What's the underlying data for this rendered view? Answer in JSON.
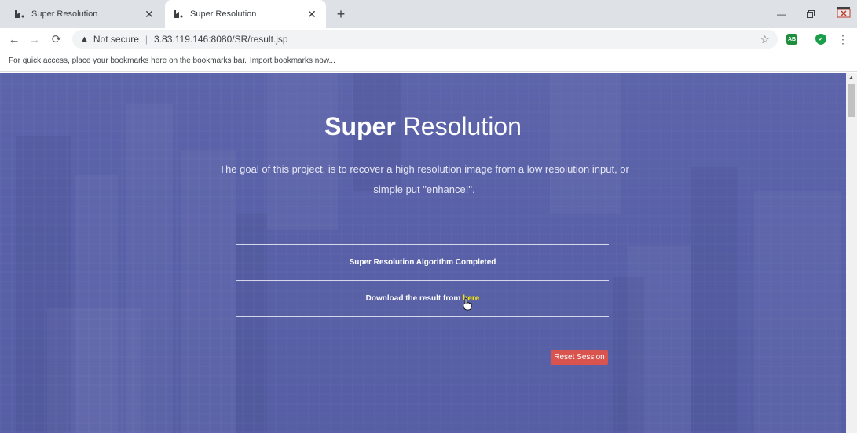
{
  "tabs": [
    {
      "title": "Super Resolution",
      "active": false
    },
    {
      "title": "Super Resolution",
      "active": true
    }
  ],
  "toolbar": {
    "security_label": "Not secure",
    "url": "3.83.119.146:8080/SR/result.jsp"
  },
  "bookmarks": {
    "hint": "For quick access, place your bookmarks here on the bookmarks bar.",
    "import_link": "Import bookmarks now..."
  },
  "hero": {
    "title_bold": "Super",
    "title_light": "Resolution",
    "subtitle": "The goal of this project, is to recover a high resolution image from a low resolution input, or simple put \"enhance!\"."
  },
  "result": {
    "status": "Super Resolution Algorithm Completed",
    "download_text": "Download the result from",
    "download_link": "here"
  },
  "actions": {
    "reset_label": "Reset Session"
  },
  "colors": {
    "hero_tint": "#5a62a6",
    "reset_button": "#d9534f",
    "link_highlight": "#f7e600"
  }
}
